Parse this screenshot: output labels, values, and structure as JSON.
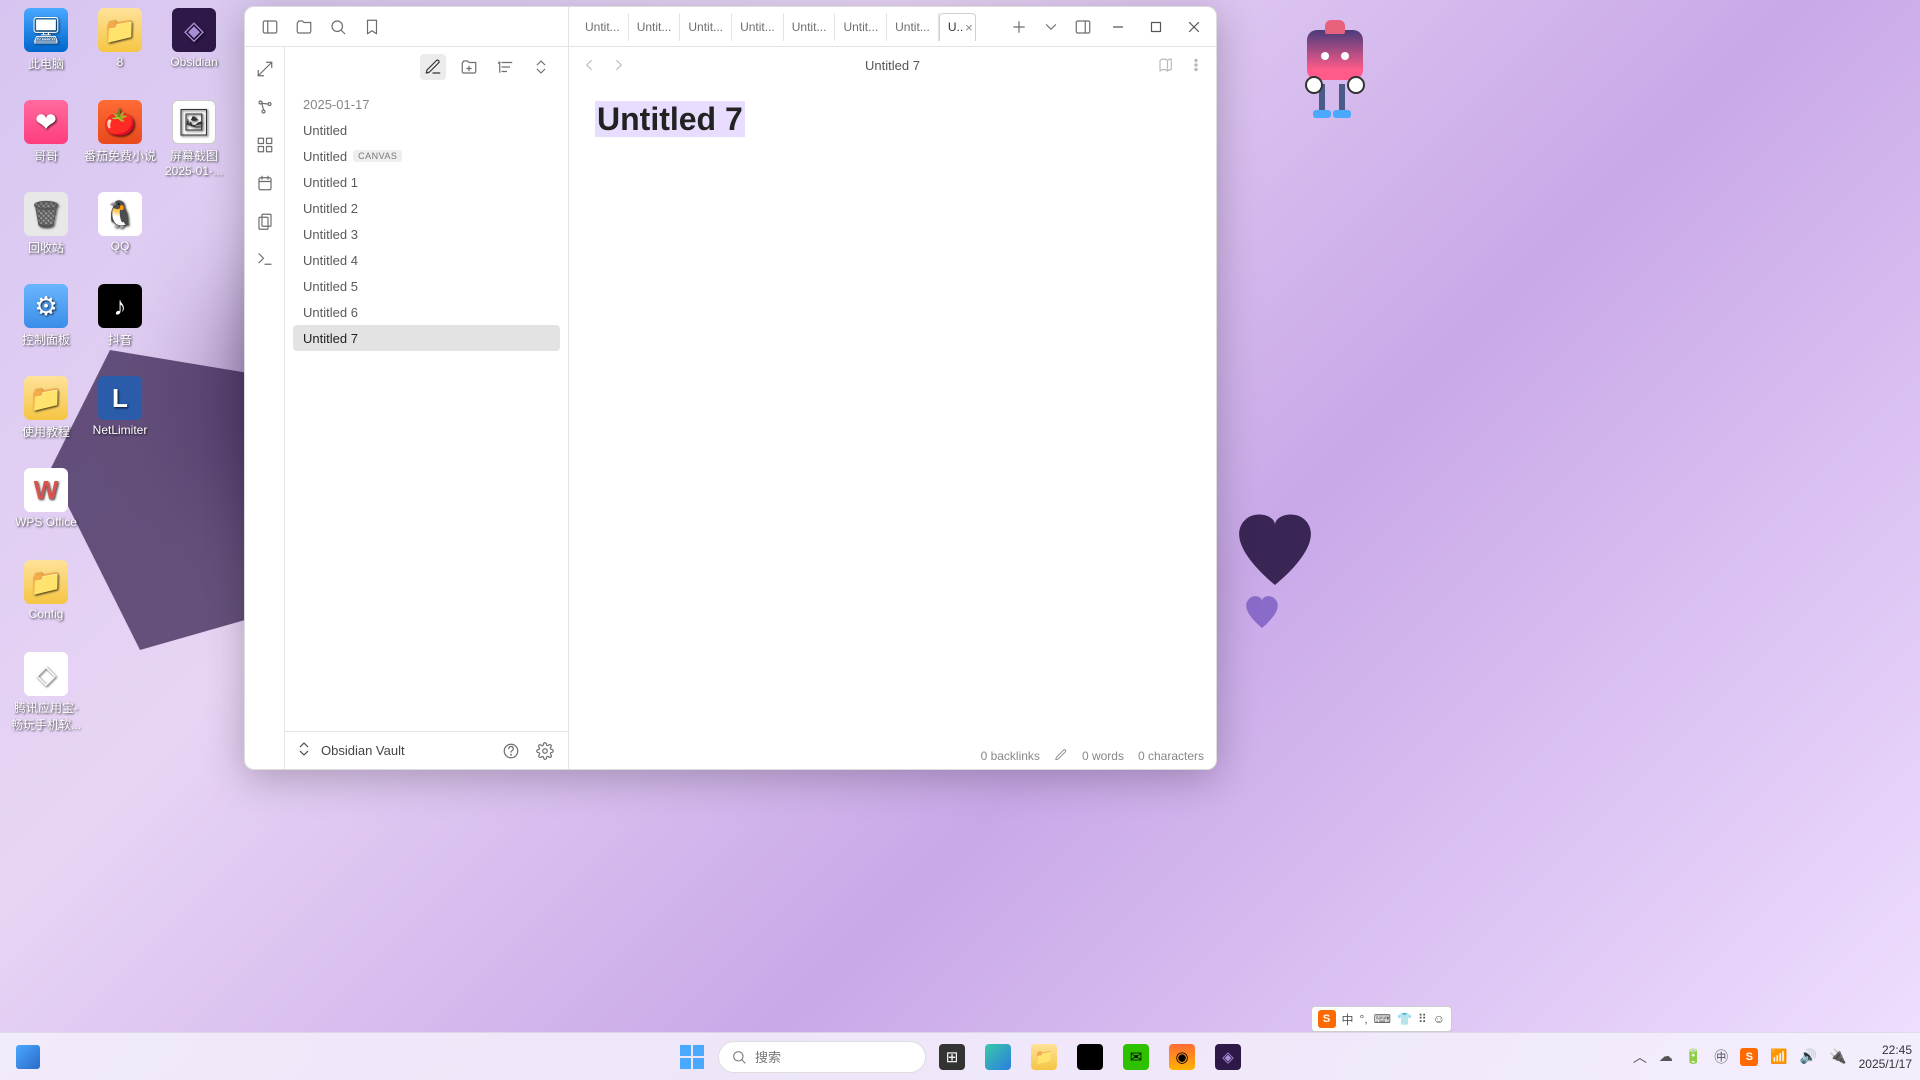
{
  "desktop": {
    "icons": [
      {
        "label": "此电脑",
        "cls": "pc",
        "glyph": "🖥"
      },
      {
        "label": "8",
        "cls": "folder",
        "glyph": "📁"
      },
      {
        "label": "Obsidian",
        "cls": "obs",
        "glyph": "◈"
      },
      {
        "label": "哥哥",
        "cls": "pink",
        "glyph": "❤"
      },
      {
        "label": "番茄免费小说",
        "cls": "red",
        "glyph": "🍅"
      },
      {
        "label": "屏幕截图 2025-01-...",
        "cls": "img",
        "glyph": "🖼"
      },
      {
        "label": "回收站",
        "cls": "bin",
        "glyph": "🗑"
      },
      {
        "label": "QQ",
        "cls": "qq",
        "glyph": "🐧"
      },
      {
        "label": "控制面板",
        "cls": "ctrl",
        "glyph": "⚙"
      },
      {
        "label": "抖音",
        "cls": "dy",
        "glyph": "♪"
      },
      {
        "label": "使用教程",
        "cls": "tut",
        "glyph": "📁"
      },
      {
        "label": "NetLimiter",
        "cls": "nl",
        "glyph": "L"
      },
      {
        "label": "WPS Office",
        "cls": "wps",
        "glyph": "W"
      },
      {
        "label": "Config",
        "cls": "folder",
        "glyph": "📁"
      },
      {
        "label": "腾讯应用宝-畅玩手机软...",
        "cls": "gen",
        "glyph": "◇"
      }
    ]
  },
  "obsidian": {
    "tabs": [
      "Untit...",
      "Untit...",
      "Untit...",
      "Untit...",
      "Untit...",
      "Untit...",
      "Untit...",
      "U.."
    ],
    "files": {
      "date": "2025-01-17",
      "items": [
        {
          "name": "Untitled",
          "badge": ""
        },
        {
          "name": "Untitled",
          "badge": "CANVAS"
        },
        {
          "name": "Untitled 1",
          "badge": ""
        },
        {
          "name": "Untitled 2",
          "badge": ""
        },
        {
          "name": "Untitled 3",
          "badge": ""
        },
        {
          "name": "Untitled 4",
          "badge": ""
        },
        {
          "name": "Untitled 5",
          "badge": ""
        },
        {
          "name": "Untitled 6",
          "badge": ""
        },
        {
          "name": "Untitled 7",
          "badge": ""
        }
      ],
      "selected": 8
    },
    "vault_name": "Obsidian Vault",
    "editor": {
      "tab_title": "Untitled 7",
      "doc_title": "Untitled 7",
      "backlinks": "0 backlinks",
      "words": "0 words",
      "chars": "0 characters"
    }
  },
  "taskbar": {
    "search_placeholder": "搜索",
    "ime_char": "中",
    "time": "22:45",
    "date": "2025/1/17"
  }
}
